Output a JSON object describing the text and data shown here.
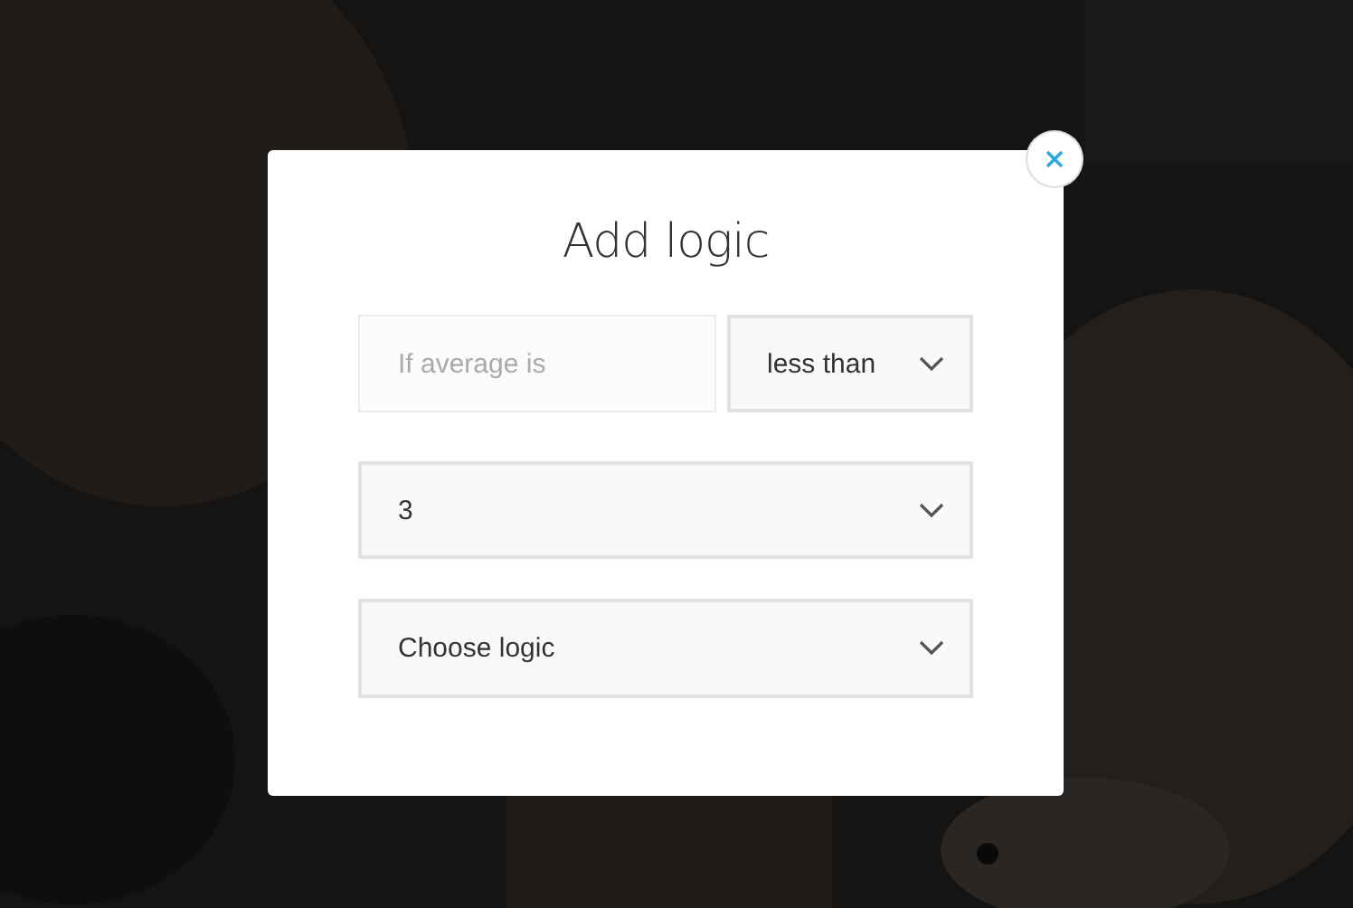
{
  "dialog": {
    "title": "Add logic"
  },
  "condition": {
    "placeholder": "If average is",
    "operator": "less than"
  },
  "value": "3",
  "logic": "Choose logic"
}
